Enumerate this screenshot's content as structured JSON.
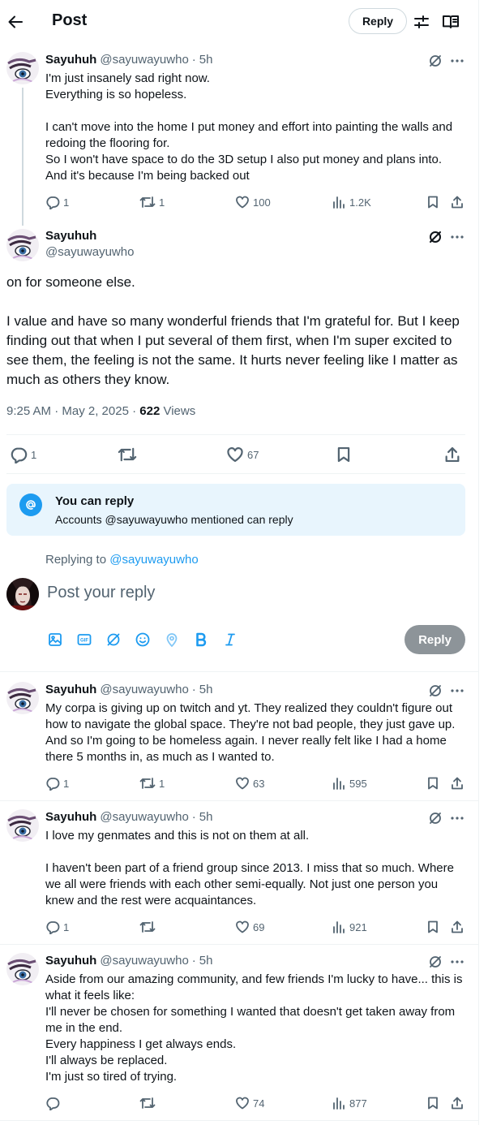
{
  "header": {
    "title": "Post",
    "reply_label": "Reply"
  },
  "author": {
    "name": "Sayuhuh",
    "handle": "@sayuwayuwho",
    "time": "5h"
  },
  "thread": [
    {
      "text": "I'm just insanely sad right now.\nEverything is so hopeless.\n\nI can't move into the home I put money and effort into painting the walls and redoing the flooring for.\nSo I won't have space to do the 3D setup I also put money and plans into.\nAnd it's because I'm being backed out",
      "replies": "1",
      "reposts": "1",
      "likes": "100",
      "views": "1.2K"
    }
  ],
  "main_post": {
    "text": "on for someone else.\n\nI value and have so many wonderful friends that I'm grateful for. But I keep finding out that when I put several of them first, when I'm super excited to see them, the feeling is not the same. It hurts never feeling like I matter as much as others they know.",
    "timestamp": "9:25 AM · May 2, 2025",
    "views_count": "622",
    "views_label": "Views",
    "replies": "1",
    "likes": "67"
  },
  "reply_notice": {
    "title": "You can reply",
    "subtitle": "Accounts @sayuwayuwho mentioned can reply"
  },
  "composer": {
    "replying_to_label": "Replying to",
    "replying_to_handle": "@sayuwayuwho",
    "placeholder": "Post your reply",
    "reply_button": "Reply"
  },
  "replies": [
    {
      "text": "My corpa is giving up on twitch and yt. They realized they couldn't figure out how to navigate the global space. They're not bad people, they just gave up.\nAnd so I'm going to be homeless again. I never really felt like I had a home there 5 months in, as much as I wanted to.",
      "replies": "1",
      "reposts": "1",
      "likes": "63",
      "views": "595"
    },
    {
      "text": "I love my genmates and this is not on them at all.\n\nI haven't been part of a friend group since 2013. I miss that so much. Where we all were friends with each other semi-equally. Not just one person you knew and the rest were acquaintances.",
      "replies": "1",
      "reposts": "",
      "likes": "69",
      "views": "921"
    },
    {
      "text": "Aside from our amazing community, and few friends I'm lucky to have... this is what it feels like:\nI'll never be chosen for something I wanted that doesn't get taken away from me in the end.\nEvery happiness I get always ends.\nI'll always be replaced.\nI'm just so tired of trying.",
      "replies": "",
      "reposts": "",
      "likes": "74",
      "views": "877"
    }
  ],
  "colors": {
    "accent": "#1d9bf0",
    "text": "#0f1419",
    "muted": "#536471",
    "notice_bg": "#e8f5fd",
    "disabled_button": "#8d9499"
  }
}
